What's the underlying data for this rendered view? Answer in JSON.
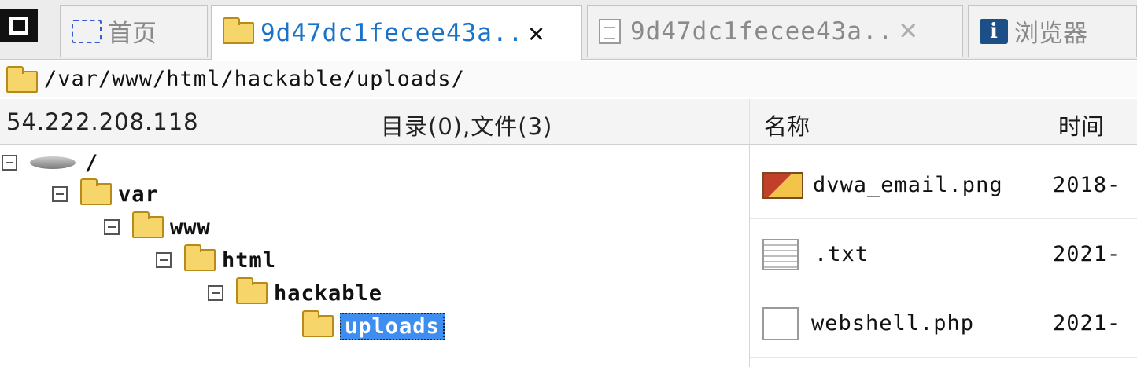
{
  "tabs": [
    {
      "label": "首页",
      "icon": "home-icon",
      "active": false
    },
    {
      "label": "9d47dc1fecee43a..",
      "icon": "folder-icon",
      "active": true
    },
    {
      "label": "9d47dc1fecee43a..",
      "icon": "document-icon",
      "active": false
    },
    {
      "label": "浏览器",
      "icon": "info-icon",
      "active": false
    }
  ],
  "tab_close_glyph": "✕",
  "path": "/var/www/html/hackable/uploads/",
  "server_ip": "54.222.208.118",
  "summary": "目录(0),文件(3)",
  "columns": {
    "name": "名称",
    "time": "时间"
  },
  "tree": {
    "root": "/",
    "nodes": [
      "var",
      "www",
      "html",
      "hackable",
      "uploads"
    ],
    "selected": "uploads"
  },
  "files": [
    {
      "name": "dvwa_email.png",
      "time": "2018-",
      "icon": "image-file-icon"
    },
    {
      "name": ".txt",
      "time": "2021-",
      "icon": "text-file-icon"
    },
    {
      "name": "webshell.php",
      "time": "2021-",
      "icon": "php-file-icon"
    }
  ],
  "colors": {
    "accent": "#1a73c9",
    "selection": "#3d8ef0",
    "folder": "#f6d66b"
  }
}
